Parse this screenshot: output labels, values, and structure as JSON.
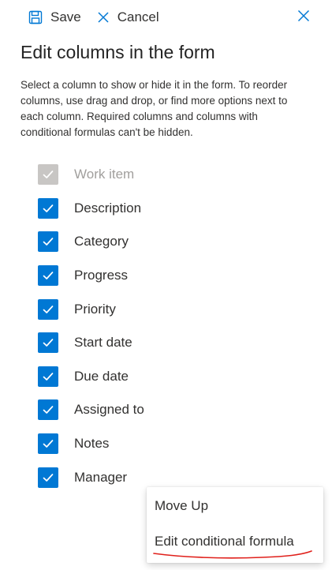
{
  "toolbar": {
    "save_label": "Save",
    "cancel_label": "Cancel"
  },
  "panel": {
    "title": "Edit columns in the form",
    "description": "Select a column to show or hide it in the form. To reorder columns, use drag and drop, or find more options next to each column. Required columns and columns with conditional formulas can't be hidden."
  },
  "columns": [
    {
      "label": "Work item",
      "checked": true,
      "disabled": true
    },
    {
      "label": "Description",
      "checked": true,
      "disabled": false
    },
    {
      "label": "Category",
      "checked": true,
      "disabled": false
    },
    {
      "label": "Progress",
      "checked": true,
      "disabled": false
    },
    {
      "label": "Priority",
      "checked": true,
      "disabled": false
    },
    {
      "label": "Start date",
      "checked": true,
      "disabled": false
    },
    {
      "label": "Due date",
      "checked": true,
      "disabled": false
    },
    {
      "label": "Assigned to",
      "checked": true,
      "disabled": false
    },
    {
      "label": "Notes",
      "checked": true,
      "disabled": false
    },
    {
      "label": "Manager",
      "checked": true,
      "disabled": false
    }
  ],
  "context_menu": {
    "move_up_label": "Move Up",
    "edit_formula_label": "Edit conditional formula"
  },
  "colors": {
    "accent": "#0078d4",
    "disabled": "#c8c6c4",
    "annotation": "#e0201b"
  }
}
